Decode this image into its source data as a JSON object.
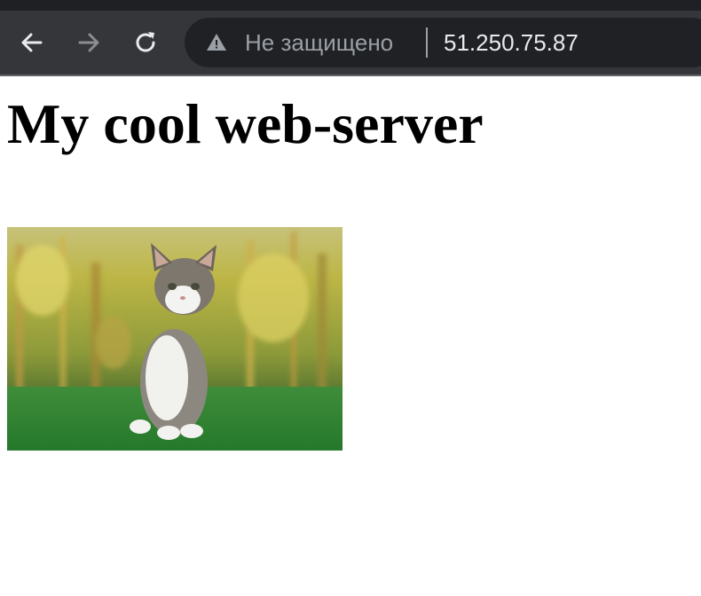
{
  "browser": {
    "security_label": "Не защищено",
    "url": "51.250.75.87",
    "colors": {
      "toolbar": "#35363a",
      "omnibox": "#202124",
      "url_text": "#e8eaed",
      "muted": "#9aa0a6"
    },
    "icons": [
      "back-arrow-icon",
      "forward-arrow-icon",
      "reload-icon",
      "warning-icon"
    ]
  },
  "page": {
    "heading": "My cool web-server",
    "image": {
      "subject": "kitten-photo",
      "colors": {
        "grass": "#2e8a34",
        "background": "#b7b548",
        "cat_white": "#f2f2f0",
        "cat_grey": "#6f6a62"
      }
    }
  }
}
